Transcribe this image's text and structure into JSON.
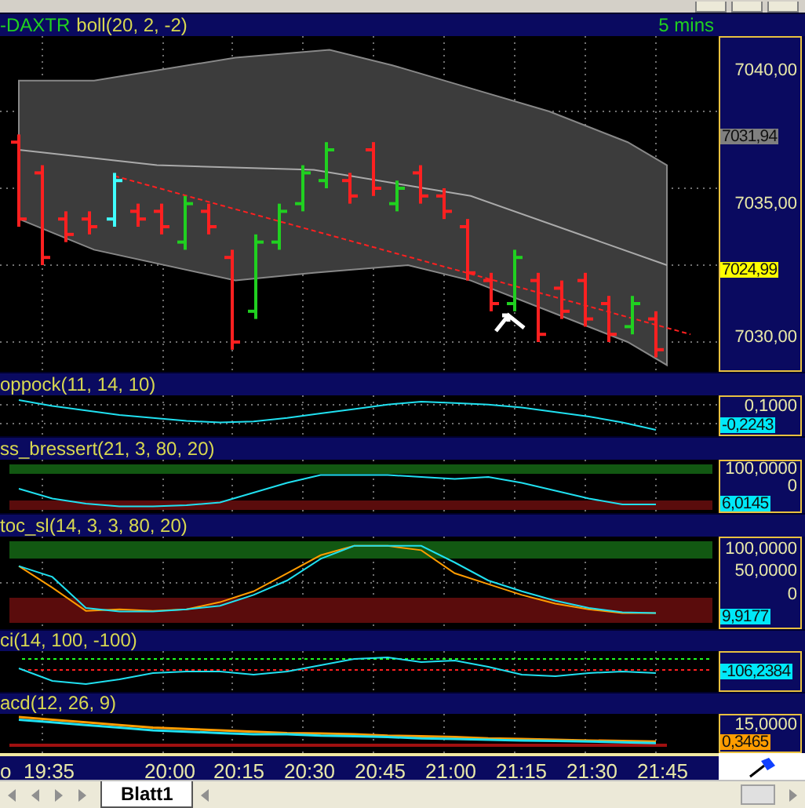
{
  "chart": {
    "symbol": "-DAXTR",
    "indicator": "boll(20, 2, -2)",
    "interval": "5 mins",
    "axis_labels": [
      "7040,00",
      "7035,00",
      "7030,00"
    ],
    "badges": [
      {
        "text": "7031,94",
        "color": "#808080"
      },
      {
        "text": "7024,99",
        "color": "#ffff00"
      }
    ]
  },
  "panes": [
    {
      "kind": "coppock",
      "title": "oppock(11, 14, 10)",
      "axis_labels": [
        "0,1000"
      ],
      "badges": [
        {
          "text": "-0,2243",
          "color": "#00e8f8"
        }
      ]
    },
    {
      "kind": "bressert",
      "title": "ss_bressert(21, 3, 80, 20)",
      "axis_labels": [
        "100,0000",
        "0"
      ],
      "badges": [
        {
          "text": "6,0145",
          "color": "#00e8f8"
        }
      ]
    },
    {
      "kind": "stoc",
      "title": "toc_sl(14, 3, 3, 80, 20)",
      "axis_labels": [
        "100,0000",
        "50,0000",
        "0"
      ],
      "badges": [
        {
          "text": "9,9177",
          "color": "#00e8f8"
        }
      ]
    },
    {
      "kind": "cci",
      "title": "ci(14, 100, -100)",
      "badges": [
        {
          "text": "-106,2384",
          "color": "#00e8f8"
        }
      ]
    },
    {
      "kind": "macd",
      "title": "acd(12, 26, 9)",
      "axis_labels": [
        "15,0000"
      ],
      "badges": [
        {
          "text": "0,3465",
          "color": "#ff9c00"
        }
      ]
    }
  ],
  "time_axis": [
    "o",
    "19:35",
    "20:00",
    "20:15",
    "20:30",
    "20:45",
    "21:00",
    "21:15",
    "21:30",
    "21:45"
  ],
  "tabs": [
    {
      "label": "Blatt1",
      "selected": true
    }
  ]
}
